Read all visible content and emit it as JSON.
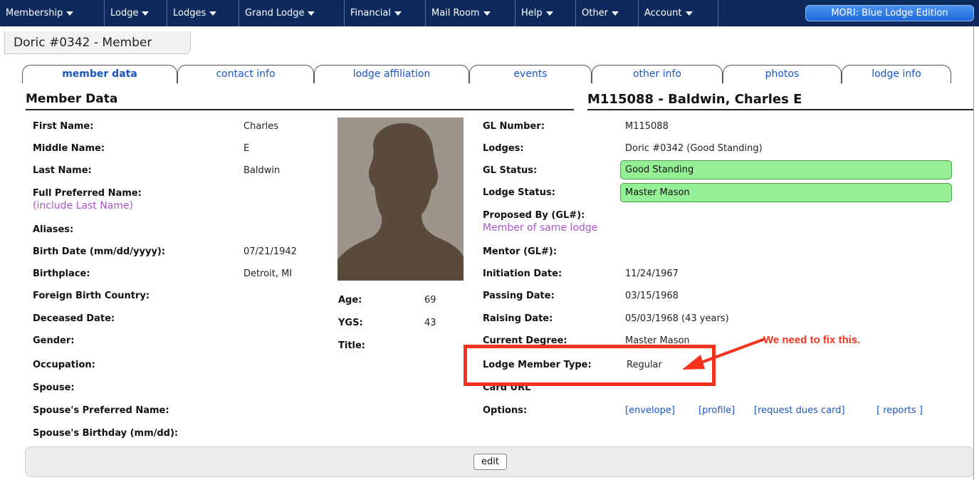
{
  "nav": {
    "items": [
      {
        "label": "Membership"
      },
      {
        "label": "Lodge"
      },
      {
        "label": "Lodges"
      },
      {
        "label": "Grand Lodge"
      },
      {
        "label": "Financial"
      },
      {
        "label": "Mail Room"
      },
      {
        "label": "Help"
      },
      {
        "label": "Other"
      },
      {
        "label": "Account"
      }
    ],
    "edition": "MORI: Blue Lodge Edition"
  },
  "breadcrumb": "Doric #0342 - Member",
  "tabs": [
    {
      "label": "member data",
      "active": true
    },
    {
      "label": "contact info",
      "active": false
    },
    {
      "label": "lodge affiliation",
      "active": false
    },
    {
      "label": "events",
      "active": false
    },
    {
      "label": "other info",
      "active": false
    },
    {
      "label": "photos",
      "active": false
    },
    {
      "label": "lodge info",
      "active": false
    }
  ],
  "section_title": "Member Data",
  "member_title": "M115088 - Baldwin, Charles E",
  "left_fields": {
    "first_name": {
      "label": "First Name:",
      "value": "Charles"
    },
    "middle_name": {
      "label": "Middle Name:",
      "value": "E"
    },
    "last_name": {
      "label": "Last Name:",
      "value": "Baldwin"
    },
    "full_preferred_name": {
      "label": "Full Preferred Name:",
      "hint": "(include Last Name)",
      "value": ""
    },
    "aliases": {
      "label": "Aliases:",
      "value": ""
    },
    "birth_date": {
      "label": "Birth Date (mm/dd/yyyy):",
      "value": "07/21/1942"
    },
    "birthplace": {
      "label": "Birthplace:",
      "value": "Detroit, MI"
    },
    "foreign_birth_country": {
      "label": "Foreign Birth Country:",
      "value": ""
    },
    "deceased_date": {
      "label": "Deceased Date:",
      "value": ""
    },
    "gender": {
      "label": "Gender:",
      "value": ""
    },
    "occupation": {
      "label": "Occupation:",
      "value": ""
    },
    "spouse": {
      "label": "Spouse:",
      "value": ""
    },
    "spouse_preferred_name": {
      "label": "Spouse's Preferred Name:",
      "value": ""
    },
    "spouse_birthday": {
      "label": "Spouse's Birthday (mm/dd):",
      "value": ""
    }
  },
  "middle_fields": {
    "age": {
      "label": "Age:",
      "value": "69"
    },
    "ygs": {
      "label": "YGS:",
      "value": "43"
    },
    "title": {
      "label": "Title:",
      "value": ""
    }
  },
  "right_fields": {
    "gl_number": {
      "label": "GL Number:",
      "value": "M115088"
    },
    "lodges": {
      "label": "Lodges:",
      "value": "Doric #0342 (Good Standing)"
    },
    "gl_status": {
      "label": "GL Status:",
      "value": "Good Standing"
    },
    "lodge_status": {
      "label": "Lodge Status:",
      "value": "Master Mason"
    },
    "proposed_by": {
      "label": "Proposed By (GL#):",
      "hint": "Member of same lodge",
      "value": ""
    },
    "mentor": {
      "label": "Mentor (GL#):",
      "value": ""
    },
    "initiation_date": {
      "label": "Initiation Date:",
      "value": "11/24/1967"
    },
    "passing_date": {
      "label": "Passing Date:",
      "value": "03/15/1968"
    },
    "raising_date": {
      "label": "Raising Date:",
      "value": "05/03/1968 (43 years)"
    },
    "current_degree": {
      "label": "Current Degree:",
      "value": "Master Mason"
    },
    "lodge_member_type": {
      "label": "Lodge Member Type:",
      "value": "Regular"
    },
    "card_url": {
      "label": "Card URL",
      "value": ""
    },
    "options": {
      "label": "Options:"
    }
  },
  "options_links": {
    "envelope": "[envelope]",
    "profile": "[profile]",
    "request_dues_card": "[request dues card]",
    "reports": "[ reports ]"
  },
  "edit_label": "edit",
  "annotation": "We need to fix this.",
  "colors": {
    "nav_bg": "#0e2a5c",
    "status_green": "#95ef95",
    "annotation_red": "#f4321e",
    "link_blue": "#1a55c4",
    "hint_purple": "#a855c8"
  }
}
